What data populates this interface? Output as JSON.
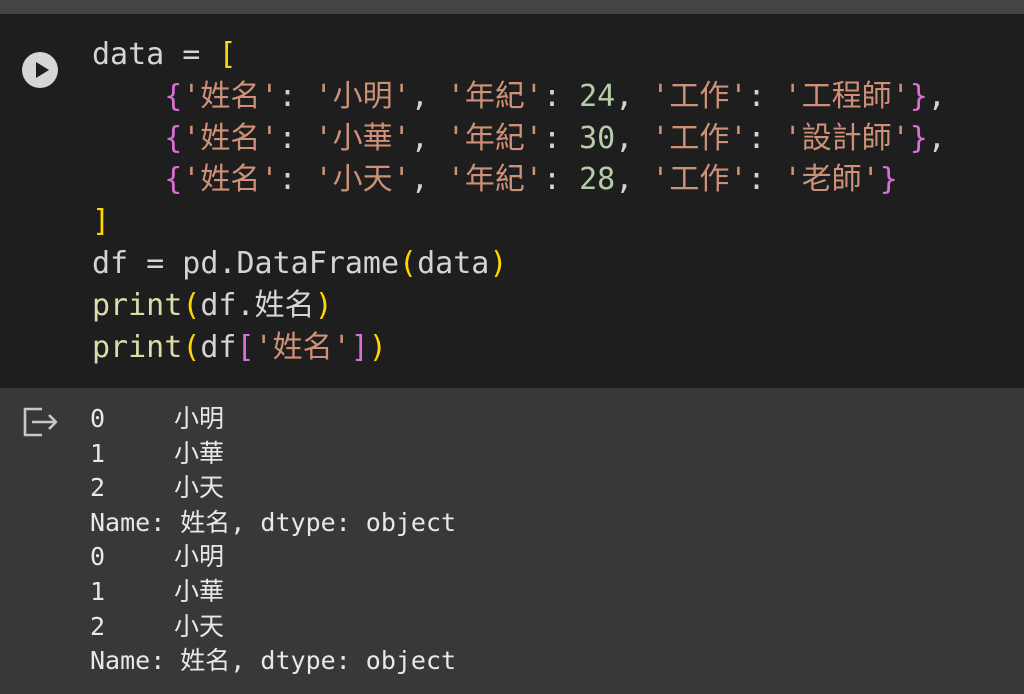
{
  "colors": {
    "editor_bg": "#1e1e1e",
    "output_bg": "#383838",
    "plain": "#d4d4d4",
    "string": "#ce9178",
    "number": "#b5cea8",
    "function": "#dcdcaa",
    "bracket_gold": "#ffd700",
    "bracket_purple": "#da70d6"
  },
  "icons": {
    "run": "play-circle-icon",
    "output": "output-redirect-icon"
  },
  "code_lines": [
    [
      {
        "t": "data = ",
        "c": "p"
      },
      {
        "t": "[",
        "c": "g"
      }
    ],
    [
      {
        "t": "    ",
        "c": "p"
      },
      {
        "t": "{",
        "c": "m"
      },
      {
        "t": "'姓名'",
        "c": "s"
      },
      {
        "t": ": ",
        "c": "p"
      },
      {
        "t": "'小明'",
        "c": "s"
      },
      {
        "t": ", ",
        "c": "p"
      },
      {
        "t": "'年紀'",
        "c": "s"
      },
      {
        "t": ": ",
        "c": "p"
      },
      {
        "t": "24",
        "c": "n"
      },
      {
        "t": ", ",
        "c": "p"
      },
      {
        "t": "'工作'",
        "c": "s"
      },
      {
        "t": ": ",
        "c": "p"
      },
      {
        "t": "'工程師'",
        "c": "s"
      },
      {
        "t": "}",
        "c": "m"
      },
      {
        "t": ",",
        "c": "p"
      }
    ],
    [
      {
        "t": "    ",
        "c": "p"
      },
      {
        "t": "{",
        "c": "m"
      },
      {
        "t": "'姓名'",
        "c": "s"
      },
      {
        "t": ": ",
        "c": "p"
      },
      {
        "t": "'小華'",
        "c": "s"
      },
      {
        "t": ", ",
        "c": "p"
      },
      {
        "t": "'年紀'",
        "c": "s"
      },
      {
        "t": ": ",
        "c": "p"
      },
      {
        "t": "30",
        "c": "n"
      },
      {
        "t": ", ",
        "c": "p"
      },
      {
        "t": "'工作'",
        "c": "s"
      },
      {
        "t": ": ",
        "c": "p"
      },
      {
        "t": "'設計師'",
        "c": "s"
      },
      {
        "t": "}",
        "c": "m"
      },
      {
        "t": ",",
        "c": "p"
      }
    ],
    [
      {
        "t": "    ",
        "c": "p"
      },
      {
        "t": "{",
        "c": "m"
      },
      {
        "t": "'姓名'",
        "c": "s"
      },
      {
        "t": ": ",
        "c": "p"
      },
      {
        "t": "'小天'",
        "c": "s"
      },
      {
        "t": ", ",
        "c": "p"
      },
      {
        "t": "'年紀'",
        "c": "s"
      },
      {
        "t": ": ",
        "c": "p"
      },
      {
        "t": "28",
        "c": "n"
      },
      {
        "t": ", ",
        "c": "p"
      },
      {
        "t": "'工作'",
        "c": "s"
      },
      {
        "t": ": ",
        "c": "p"
      },
      {
        "t": "'老師'",
        "c": "s"
      },
      {
        "t": "}",
        "c": "m"
      }
    ],
    [
      {
        "t": "]",
        "c": "g"
      }
    ],
    [
      {
        "t": "df = pd.DataFrame",
        "c": "p"
      },
      {
        "t": "(",
        "c": "g"
      },
      {
        "t": "data",
        "c": "p"
      },
      {
        "t": ")",
        "c": "g"
      }
    ],
    [
      {
        "t": "print",
        "c": "f"
      },
      {
        "t": "(",
        "c": "g"
      },
      {
        "t": "df.姓名",
        "c": "p"
      },
      {
        "t": ")",
        "c": "g"
      }
    ],
    [
      {
        "t": "print",
        "c": "f"
      },
      {
        "t": "(",
        "c": "g"
      },
      {
        "t": "df",
        "c": "p"
      },
      {
        "t": "[",
        "c": "m"
      },
      {
        "t": "'姓名'",
        "c": "s"
      },
      {
        "t": "]",
        "c": "m"
      },
      {
        "t": ")",
        "c": "g"
      }
    ]
  ],
  "output_lines": [
    {
      "idx": "0",
      "val": "小明"
    },
    {
      "idx": "1",
      "val": "小華"
    },
    {
      "idx": "2",
      "val": "小天"
    },
    {
      "text": "Name: 姓名, dtype: object"
    },
    {
      "idx": "0",
      "val": "小明"
    },
    {
      "idx": "1",
      "val": "小華"
    },
    {
      "idx": "2",
      "val": "小天"
    },
    {
      "text": "Name: 姓名, dtype: object"
    }
  ]
}
